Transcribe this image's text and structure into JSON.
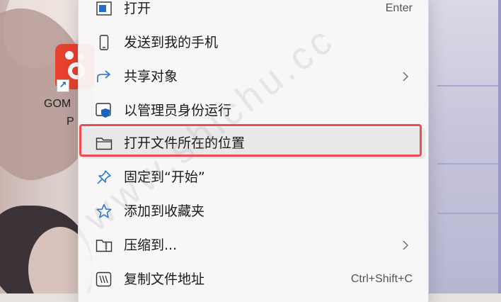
{
  "desktop": {
    "icon_label_line1": "GOM",
    "icon_label_line2": "P",
    "icon_name": "gom-player-app-icon"
  },
  "menu": {
    "items": [
      {
        "label": "打开",
        "shortcut": "Enter",
        "icon": "open-window-icon"
      },
      {
        "label": "发送到我的手机",
        "icon": "phone-icon"
      },
      {
        "label": "共享对象",
        "submenu": true,
        "icon": "share-icon"
      },
      {
        "label": "以管理员身份运行",
        "icon": "admin-shield-icon"
      },
      {
        "label": "打开文件所在的位置",
        "icon": "folder-icon",
        "highlighted": true
      },
      {
        "label": "固定到“开始”",
        "icon": "pin-icon"
      },
      {
        "label": "添加到收藏夹",
        "icon": "star-icon"
      },
      {
        "label": "压缩到...",
        "submenu": true,
        "icon": "zip-folder-icon"
      },
      {
        "label": "复制文件地址",
        "shortcut": "Ctrl+Shift+C",
        "icon": "copy-path-icon"
      }
    ]
  },
  "watermark": "www.shichu.cc",
  "colors": {
    "highlight_border": "#ef4b55",
    "shield_blue": "#1565c0",
    "app_red": "#e8412f"
  }
}
